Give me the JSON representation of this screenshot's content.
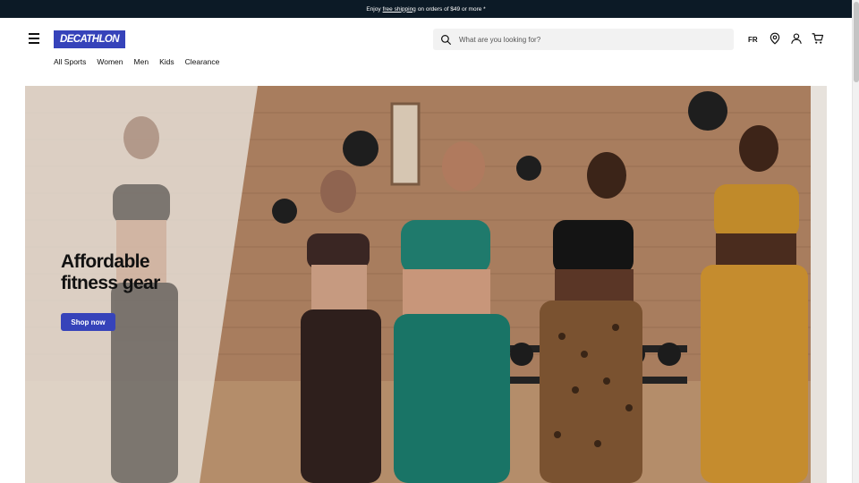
{
  "promo": {
    "prefix": "Enjoy",
    "link": "free shipping",
    "suffix": "on orders of $49 or more *"
  },
  "header": {
    "logo": "DECATHLON",
    "search_placeholder": "What are you looking for?",
    "lang": "FR",
    "icons": [
      "menu-icon",
      "search-icon",
      "location-pin-icon",
      "account-icon",
      "cart-icon"
    ]
  },
  "nav": [
    {
      "label": "All Sports"
    },
    {
      "label": "Women"
    },
    {
      "label": "Men"
    },
    {
      "label": "Kids"
    },
    {
      "label": "Clearance"
    }
  ],
  "hero": {
    "title": "Affordable\nfitness gear",
    "cta": "Shop now"
  },
  "colors": {
    "brand": "#3643ba",
    "promo_bg": "#0c1a26",
    "search_bg": "#f2f2f2"
  }
}
